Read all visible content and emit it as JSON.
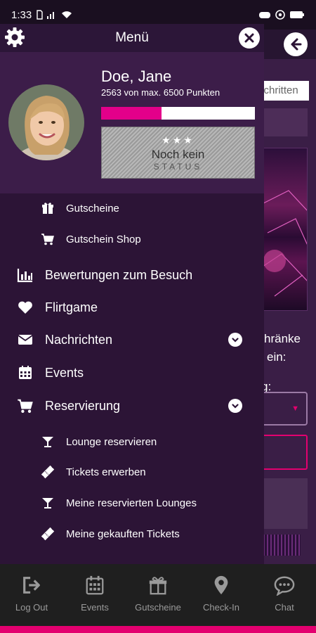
{
  "status_bar": {
    "time": "1:33"
  },
  "drawer": {
    "title": "Menü",
    "user": {
      "name": "Doe, Jane",
      "points_text": "2563  von max. 6500 Punkten",
      "points": 2563,
      "max_points": 6500
    },
    "status_badge": {
      "line1": "Noch kein",
      "line2": "STATUS"
    },
    "menu": [
      {
        "label": "Gutscheine",
        "icon": "gift-icon",
        "level": "sub"
      },
      {
        "label": "Gutschein Shop",
        "icon": "cart-icon",
        "level": "sub"
      },
      {
        "label": "Bewertungen zum Besuch",
        "icon": "bar-chart-icon",
        "level": "main"
      },
      {
        "label": "Flirtgame",
        "icon": "heart-icon",
        "level": "main"
      },
      {
        "label": "Nachrichten",
        "icon": "envelope-icon",
        "level": "main",
        "expandable": true
      },
      {
        "label": "Events",
        "icon": "calendar-icon",
        "level": "main"
      },
      {
        "label": "Reservierung",
        "icon": "cart-icon",
        "level": "main",
        "expandable": true
      },
      {
        "label": "Lounge reservieren",
        "icon": "cocktail-icon",
        "level": "sub"
      },
      {
        "label": "Tickets erwerben",
        "icon": "ticket-icon",
        "level": "sub"
      },
      {
        "label": "Meine reservierten Lounges",
        "icon": "cocktail-icon",
        "level": "sub"
      },
      {
        "label": "Meine gekauften Tickets",
        "icon": "ticket-icon",
        "level": "sub"
      }
    ]
  },
  "background": {
    "search_placeholder": "schritten",
    "text_line1": "hränke",
    "text_line2": "ein:",
    "text_line3": "g:"
  },
  "bottom_nav": [
    {
      "label": "Log Out",
      "icon": "logout-icon"
    },
    {
      "label": "Events",
      "icon": "calendar-icon"
    },
    {
      "label": "Gutscheine",
      "icon": "gift-icon"
    },
    {
      "label": "Check-In",
      "icon": "map-pin-icon"
    },
    {
      "label": "Chat",
      "icon": "chat-bubble-icon"
    }
  ],
  "colors": {
    "accent": "#e3006f",
    "drawer_bg": "#2c1436",
    "header_bg": "#3c1d49",
    "nav_bg": "#1f1f1f"
  }
}
